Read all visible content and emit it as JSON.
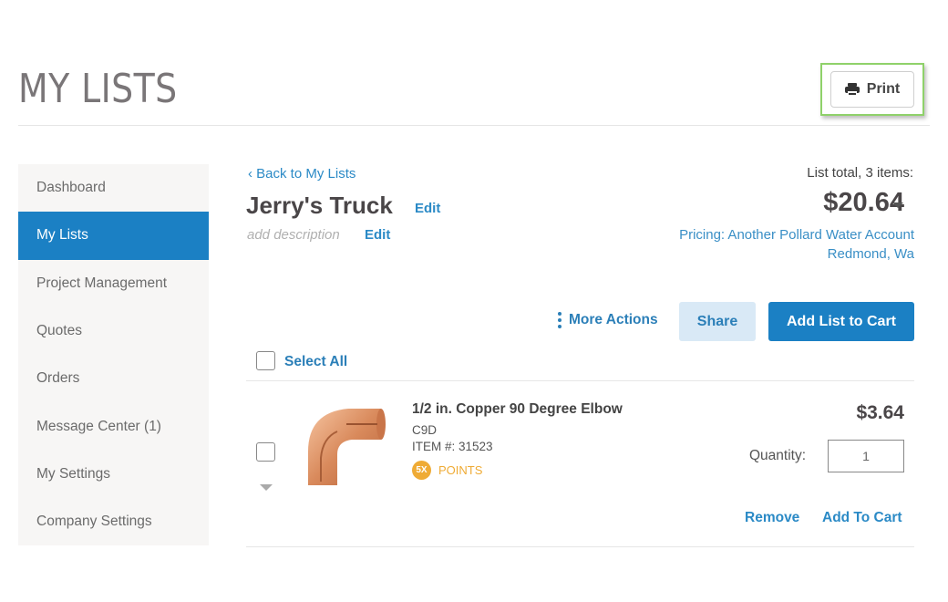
{
  "header": {
    "title": "MY LISTS",
    "print_label": "Print",
    "print_icon": "printer-icon"
  },
  "sidebar": {
    "active_index": 1,
    "items": [
      {
        "label": "Dashboard"
      },
      {
        "label": "My Lists"
      },
      {
        "label": "Project Management"
      },
      {
        "label": "Quotes"
      },
      {
        "label": "Orders"
      },
      {
        "label": "Message Center (1)"
      },
      {
        "label": "My Settings"
      },
      {
        "label": "Company Settings"
      }
    ]
  },
  "list": {
    "back_link": "‹ Back to My Lists",
    "name": "Jerry's Truck",
    "name_edit": "Edit",
    "description_placeholder": "add description",
    "description_edit": "Edit",
    "total_label": "List total, 3 items:",
    "total_amount": "$20.64",
    "pricing": "Pricing: Another Pollard Water Account",
    "pricing_location": "Redmond, Wa"
  },
  "actions": {
    "more_actions": "More Actions",
    "share": "Share",
    "add_list_to_cart": "Add List to Cart",
    "select_all": "Select All"
  },
  "items": [
    {
      "name": "1/2 in. Copper 90 Degree Elbow",
      "code": "C9D",
      "item_number": "ITEM #: 31523",
      "points_badge": "5X",
      "points_label": "POINTS",
      "price": "$3.64",
      "quantity_label": "Quantity:",
      "quantity": "1",
      "remove": "Remove",
      "add_to_cart": "Add To Cart",
      "checked": false
    }
  ],
  "colors": {
    "primary": "#1b80c4",
    "link": "#2b8ac6",
    "share_bg": "#d9e9f6",
    "points": "#efab35",
    "highlight": "#8fd16a"
  }
}
